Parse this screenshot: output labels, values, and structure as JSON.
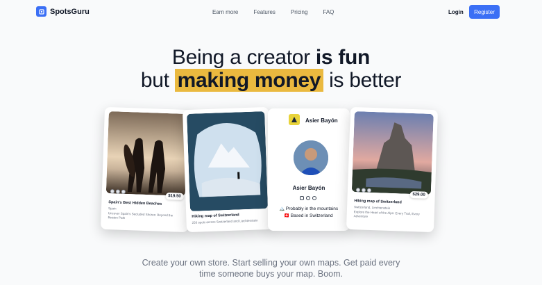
{
  "brand": {
    "name": "SpotsGuru",
    "accent": "#3b6ff5"
  },
  "nav": {
    "links": [
      "Earn more",
      "Features",
      "Pricing",
      "FAQ"
    ],
    "login": "Login",
    "register": "Register"
  },
  "hero": {
    "line1_a": "Being a creator ",
    "line1_b": "is fun",
    "line2_a": "but ",
    "line2_highlight": "making money",
    "line2_b": " is better",
    "highlight_color": "#eab93f"
  },
  "subtitle": {
    "line1": "Create your own store. Start selling your own maps. Get paid every",
    "line2": "time someone buys your map. Boom."
  },
  "cards": {
    "beaches": {
      "price": "$19.50",
      "title": "Spain's Best Hidden Beaches",
      "location": "Spain",
      "description": "Uncover Spain's Secluded Shores: Beyond the Beaten Path"
    },
    "switzerland": {
      "title": "Hiking map of Switzerland",
      "description": "250 spots across Switzerland and Liechtenstein"
    },
    "profile": {
      "header_name": "Asier Bayón",
      "name": "Asier Bayón",
      "line1": "Probably in the mountains",
      "line2": "Based in Switzerland",
      "emoji1": "🏔️",
      "emoji2": "🇨🇭"
    },
    "liechtenstein": {
      "price": "$29.00",
      "title": "Hiking map of Switzerland",
      "location": "Switzerland, Liechtenstein",
      "description": "Explore the Heart of the Alps: Every Trail, Every Adventure"
    }
  }
}
